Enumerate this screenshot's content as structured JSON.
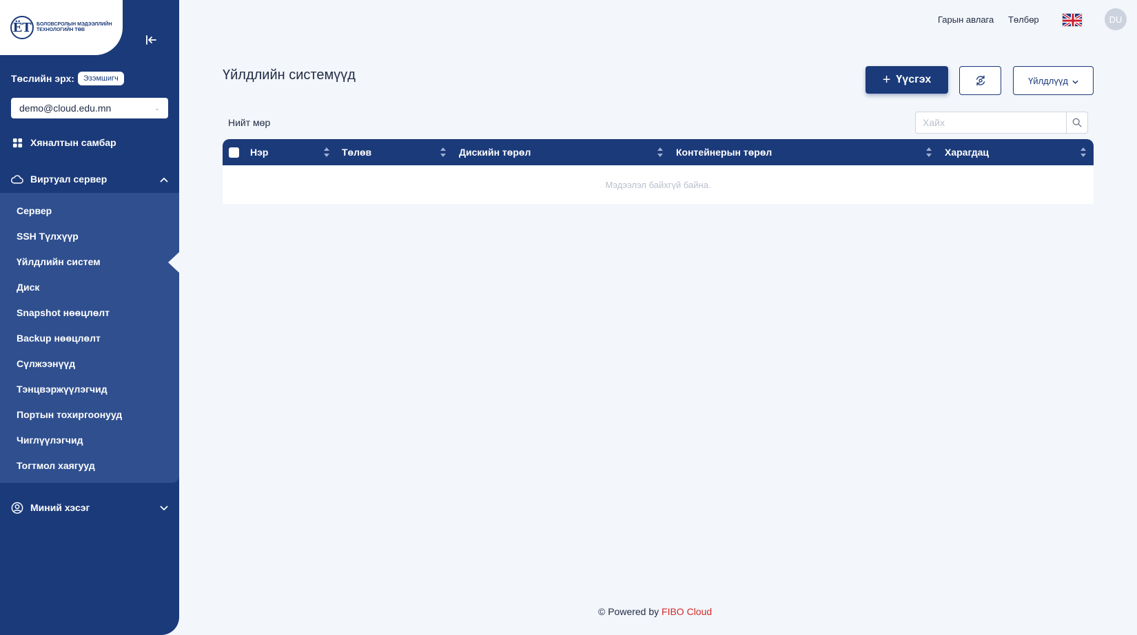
{
  "brand": {
    "logo_mark": "ЁТ",
    "logo_text": "БОЛОВСРОЛЫН МЭДЭЭЛЛИЙН ТЕХНОЛОГИЙН ТӨВ"
  },
  "sidebar": {
    "role_label": "Төслийн эрх:",
    "role_badge": "Эзэмшигч",
    "account": "demo@cloud.edu.mn",
    "dashboard": "Хяналтын самбар",
    "virtual_server": "Виртуал сервер",
    "sub_items": [
      "Сервер",
      "SSH Түлхүүр",
      "Үйлдлийн систем",
      "Диск",
      "Snapshot нөөцлөлт",
      "Backup нөөцлөлт",
      "Сүлжээнүүд",
      "Тэнцвэржүүлэгчид",
      "Портын тохиргоонууд",
      "Чиглүүлэгчид",
      "Тогтмол хаягууд"
    ],
    "my_section": "Миний хэсэг"
  },
  "header": {
    "guide": "Гарын авлага",
    "payment": "Төлбөр",
    "avatar": "DU"
  },
  "main": {
    "title": "Үйлдлийн системүүд",
    "add_label": "Үүсгэх",
    "actions_label": "Үйлдлүүд",
    "total_label": "Нийт мөр",
    "search_placeholder": "Хайх",
    "columns": [
      "Нэр",
      "Төлөв",
      "Дискийн төрөл",
      "Контейнерын төрөл",
      "Харагдац"
    ],
    "empty_text": "Мэдээлэл байхгүй байна."
  },
  "footer": {
    "prefix": "© Powered by ",
    "brand": "FIBO Cloud"
  },
  "colors": {
    "primary": "#1b3a7a",
    "submenu": "#2f4f8f",
    "accent_red": "#d12a2a"
  }
}
